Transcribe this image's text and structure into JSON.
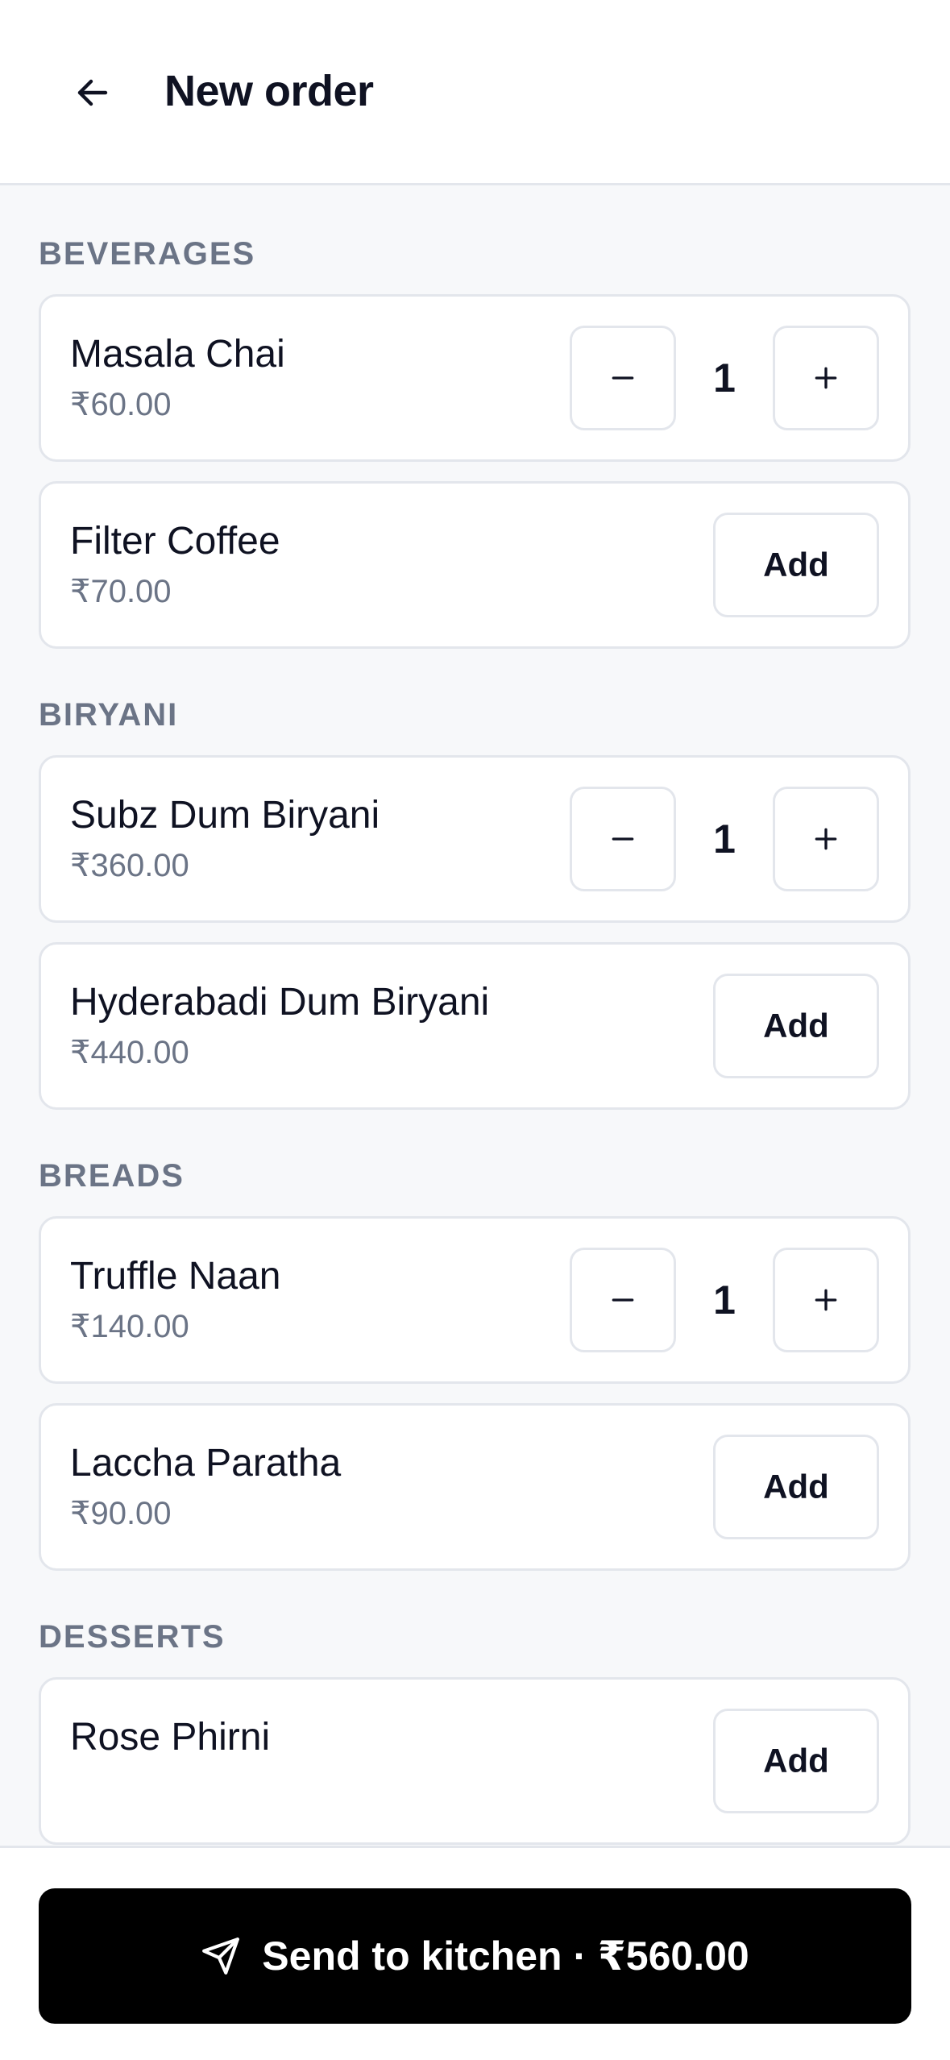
{
  "header": {
    "title": "New order",
    "back_icon": "arrow-left-icon"
  },
  "sections": [
    {
      "title": "BEVERAGES",
      "items": [
        {
          "name": "Masala Chai",
          "price": "₹60.00",
          "qty": "1",
          "in_cart": true
        },
        {
          "name": "Filter Coffee",
          "price": "₹70.00",
          "in_cart": false,
          "add_label": "Add"
        }
      ]
    },
    {
      "title": "BIRYANI",
      "items": [
        {
          "name": "Subz Dum Biryani",
          "price": "₹360.00",
          "qty": "1",
          "in_cart": true
        },
        {
          "name": "Hyderabadi Dum Biryani",
          "price": "₹440.00",
          "in_cart": false,
          "add_label": "Add"
        }
      ]
    },
    {
      "title": "BREADS",
      "items": [
        {
          "name": "Truffle Naan",
          "price": "₹140.00",
          "qty": "1",
          "in_cart": true
        },
        {
          "name": "Laccha Paratha",
          "price": "₹90.00",
          "in_cart": false,
          "add_label": "Add"
        }
      ]
    },
    {
      "title": "DESSERTS",
      "items": [
        {
          "name": "Rose Phirni",
          "price": "",
          "in_cart": false,
          "add_label": "Add"
        }
      ]
    }
  ],
  "footer": {
    "send_label": "Send to kitchen · ₹560.00",
    "send_icon": "send-icon"
  },
  "colors": {
    "background": "#f7f8fa",
    "card": "#ffffff",
    "border": "#e3e6ec",
    "muted_text": "#6b7486",
    "primary_text": "#0f1222",
    "primary_button": "#000000"
  }
}
